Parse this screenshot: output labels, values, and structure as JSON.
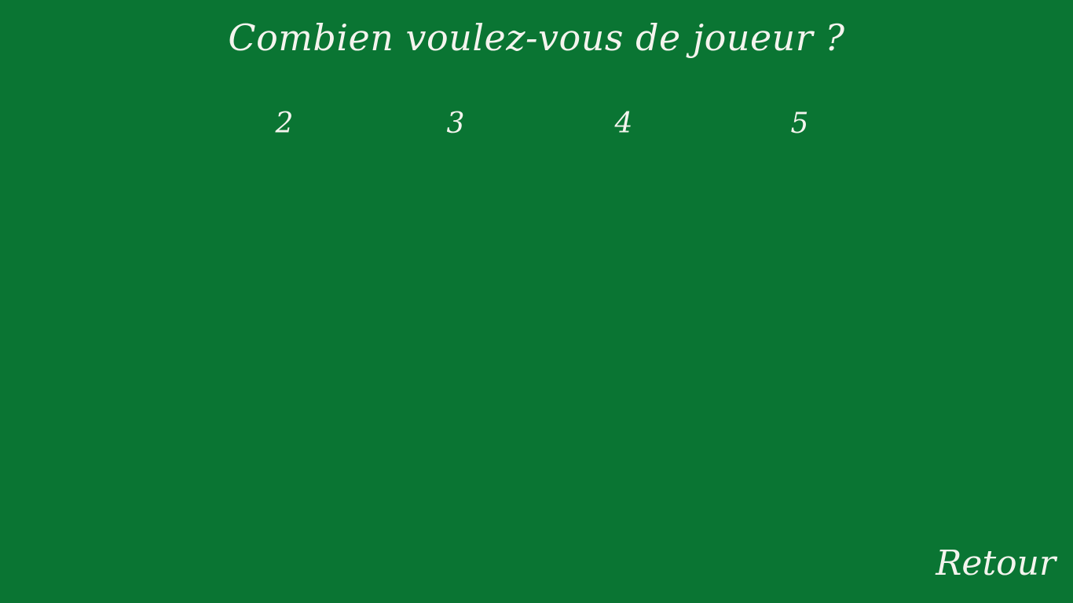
{
  "screen": {
    "title": "Combien voulez-vous de joueur ?",
    "background_color": "#0a7533",
    "text_color": "#f4f4ee"
  },
  "player_options": [
    {
      "label": "2"
    },
    {
      "label": "3"
    },
    {
      "label": "4"
    },
    {
      "label": "5"
    }
  ],
  "navigation": {
    "back_label": "Retour"
  }
}
